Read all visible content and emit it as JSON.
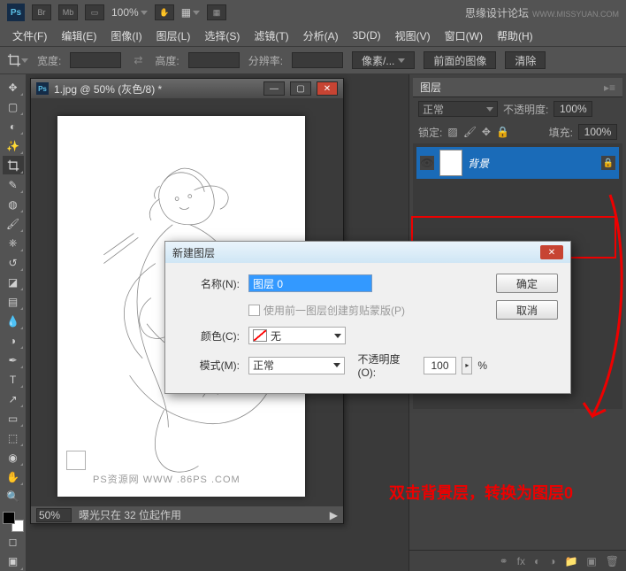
{
  "topbar": {
    "zoom": "100%",
    "brand": "思缘设计论坛",
    "brand_url": "WWW.MISSYUAN.COM",
    "br": "Br",
    "mb": "Mb",
    "screen_icon": "▭"
  },
  "menu": {
    "file": "文件(F)",
    "edit": "编辑(E)",
    "image": "图像(I)",
    "layer": "图层(L)",
    "select": "选择(S)",
    "filter": "滤镜(T)",
    "analysis": "分析(A)",
    "threed": "3D(D)",
    "view": "视图(V)",
    "window": "窗口(W)",
    "help": "帮助(H)"
  },
  "options": {
    "width": "宽度:",
    "height": "高度:",
    "resolution": "分辨率:",
    "pixels": "像素/...",
    "front_image": "前面的图像",
    "clear": "清除"
  },
  "doc": {
    "title": "1.jpg @ 50% (灰色/8) *",
    "zoom": "50%",
    "status": "曝光只在 32 位起作用",
    "watermark": "PS资源网  WWW .86PS .COM"
  },
  "panel": {
    "tab": "图层",
    "blend": "正常",
    "opacity_label": "不透明度:",
    "opacity": "100%",
    "lock_label": "锁定:",
    "fill_label": "填充:",
    "fill": "100%",
    "layer_name": "背景"
  },
  "dialog": {
    "title": "新建图层",
    "name_label": "名称(N):",
    "name_value": "图层 0",
    "clip_label": "使用前一图层创建剪贴蒙版(P)",
    "color_label": "颜色(C):",
    "color_value": "无",
    "mode_label": "模式(M):",
    "mode_value": "正常",
    "opacity_label": "不透明度(O):",
    "opacity_value": "100",
    "percent": "%",
    "ok": "确定",
    "cancel": "取消"
  },
  "annotation": "双击背景层，转换为图层0"
}
